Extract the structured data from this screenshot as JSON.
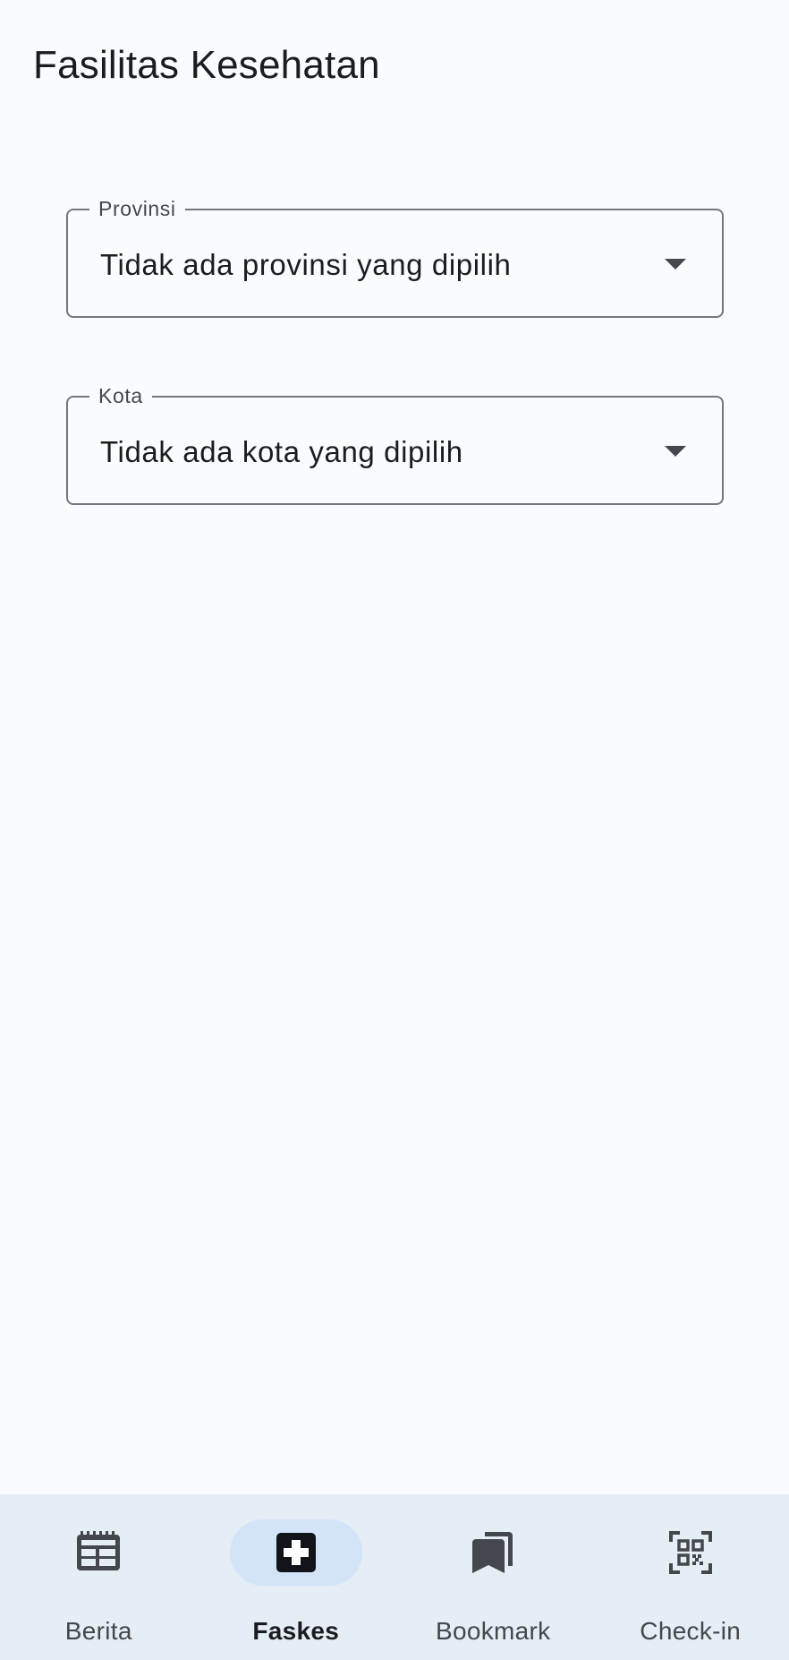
{
  "header": {
    "title": "Fasilitas Kesehatan"
  },
  "filters": {
    "provinsi": {
      "label": "Provinsi",
      "value": "Tidak ada provinsi yang dipilih"
    },
    "kota": {
      "label": "Kota",
      "value": "Tidak ada kota yang dipilih"
    }
  },
  "bottom_nav": {
    "active": "faskes",
    "items": [
      {
        "key": "berita",
        "label": "Berita",
        "icon": "newspaper-icon"
      },
      {
        "key": "faskes",
        "label": "Faskes",
        "icon": "medical-plus-icon"
      },
      {
        "key": "bookmark",
        "label": "Bookmark",
        "icon": "bookmarks-icon"
      },
      {
        "key": "checkin",
        "label": "Check-in",
        "icon": "qr-code-scanner-icon"
      }
    ]
  },
  "colors": {
    "background": "#fafbfe",
    "nav_background": "#e5edf5",
    "nav_active_indicator": "#d3e4f8",
    "outline": "#74777f",
    "text_primary": "#1b1c1f",
    "text_secondary": "#44474e"
  }
}
